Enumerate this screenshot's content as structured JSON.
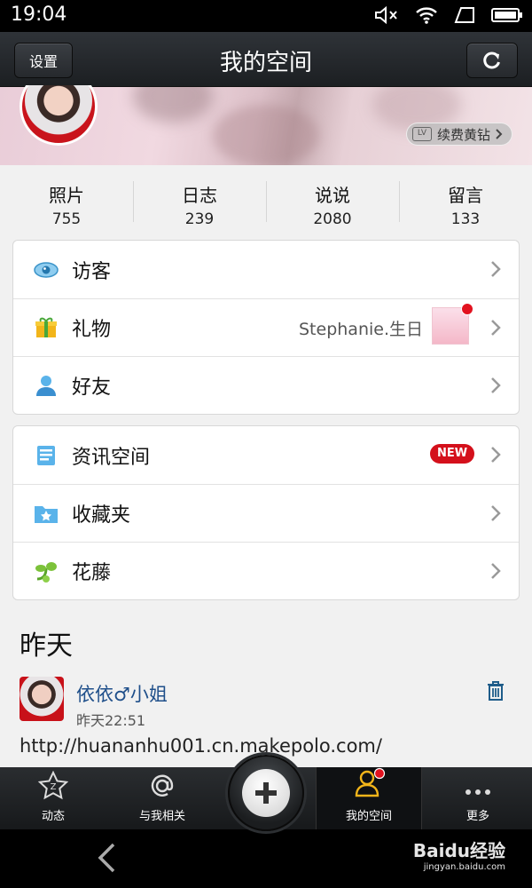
{
  "status_bar": {
    "time": "19:04"
  },
  "titlebar": {
    "title": "我的空间",
    "settings_label": "设置"
  },
  "cover": {
    "vip_label": "续费黄钻"
  },
  "stats": [
    {
      "label": "照片",
      "value": "755"
    },
    {
      "label": "日志",
      "value": "239"
    },
    {
      "label": "说说",
      "value": "2080"
    },
    {
      "label": "留言",
      "value": "133"
    }
  ],
  "menu1": [
    {
      "label": "访客",
      "icon": "eye-icon"
    },
    {
      "label": "礼物",
      "icon": "gift-icon",
      "extra": "Stephanie.生日"
    },
    {
      "label": "好友",
      "icon": "person-icon"
    }
  ],
  "menu2": [
    {
      "label": "资讯空间",
      "icon": "news-icon",
      "badge": "NEW"
    },
    {
      "label": "收藏夹",
      "icon": "star-folder-icon"
    },
    {
      "label": "花藤",
      "icon": "vine-icon"
    }
  ],
  "feed": {
    "section_title": "昨天",
    "name": "依依♂小姐",
    "time": "昨天22:51",
    "text": "http://huananhu001.cn.makepolo.com/"
  },
  "bottom_nav": {
    "tabs": [
      "动态",
      "与我相关",
      "我的空间",
      "更多"
    ],
    "active": "我的空间"
  },
  "watermark": {
    "text": "Baidu经验",
    "sub": "jingyan.baidu.com"
  },
  "colors": {
    "link_blue": "#1f4f8a",
    "badge_red": "#d4101b",
    "bar_dark": "#1c1f22"
  }
}
